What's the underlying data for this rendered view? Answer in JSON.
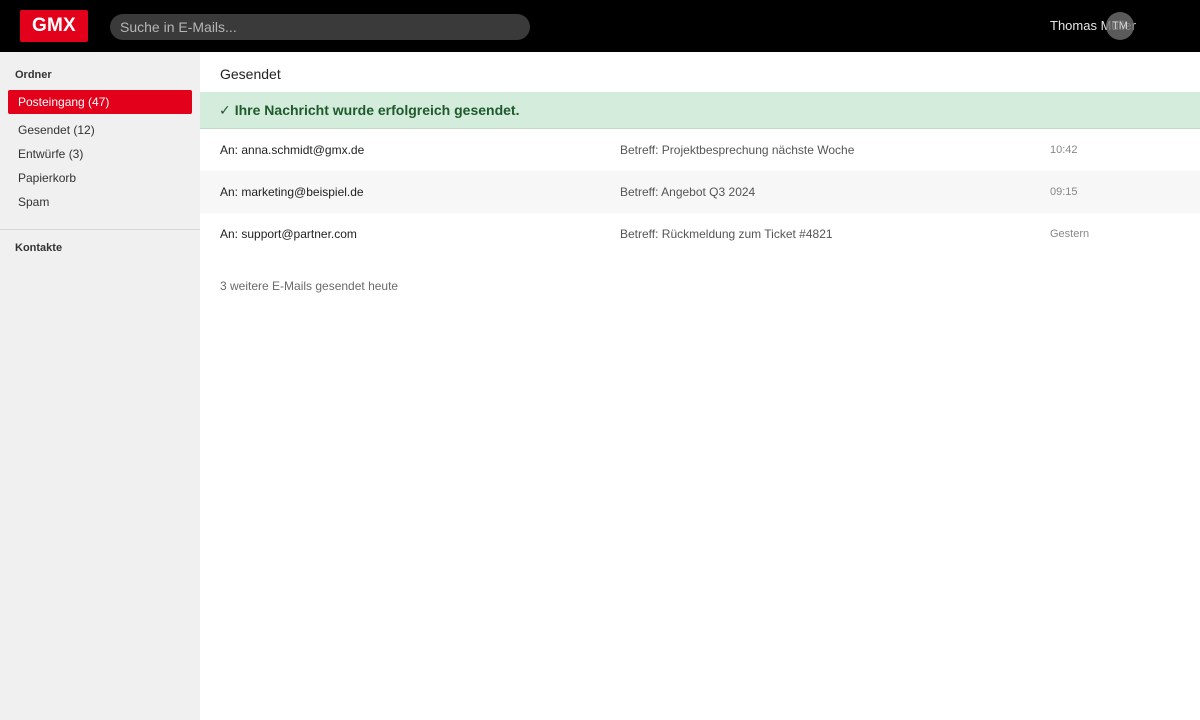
{
  "header": {
    "logo": "GMX",
    "search_placeholder": "Suche in E-Mails...",
    "user_name": "Thomas Müller",
    "user_initials": "TM"
  },
  "sidebar": {
    "folders_title": "Ordner",
    "folders": [
      {
        "label": "Posteingang (47)",
        "active": true
      },
      {
        "label": "Gesendet (12)",
        "active": false
      },
      {
        "label": "Entwürfe (3)",
        "active": false
      },
      {
        "label": "Papierkorb",
        "active": false
      },
      {
        "label": "Spam",
        "active": false
      }
    ],
    "contacts_title": "Kontakte"
  },
  "main": {
    "folder_title": "Gesendet",
    "success_message": "Ihre Nachricht wurde erfolgreich gesendet.",
    "mails": [
      {
        "to": "An: anna.schmidt@gmx.de",
        "subject": "Betreff: Projektbesprechung nächste Woche",
        "time": "10:42"
      },
      {
        "to": "An: marketing@beispiel.de",
        "subject": "Betreff: Angebot Q3 2024",
        "time": "09:15"
      },
      {
        "to": "An: support@partner.com",
        "subject": "Betreff: Rückmeldung zum Ticket #4821",
        "time": "Gestern"
      }
    ],
    "more_info": "3 weitere E-Mails gesendet heute"
  },
  "colors": {
    "brand": "#e2001a",
    "topbar": "#000000",
    "sidebar": "#f0f0f0",
    "success_bg": "#d4ecdb",
    "success_text": "#1e5a2c"
  },
  "icons": {
    "success": "check-icon"
  }
}
